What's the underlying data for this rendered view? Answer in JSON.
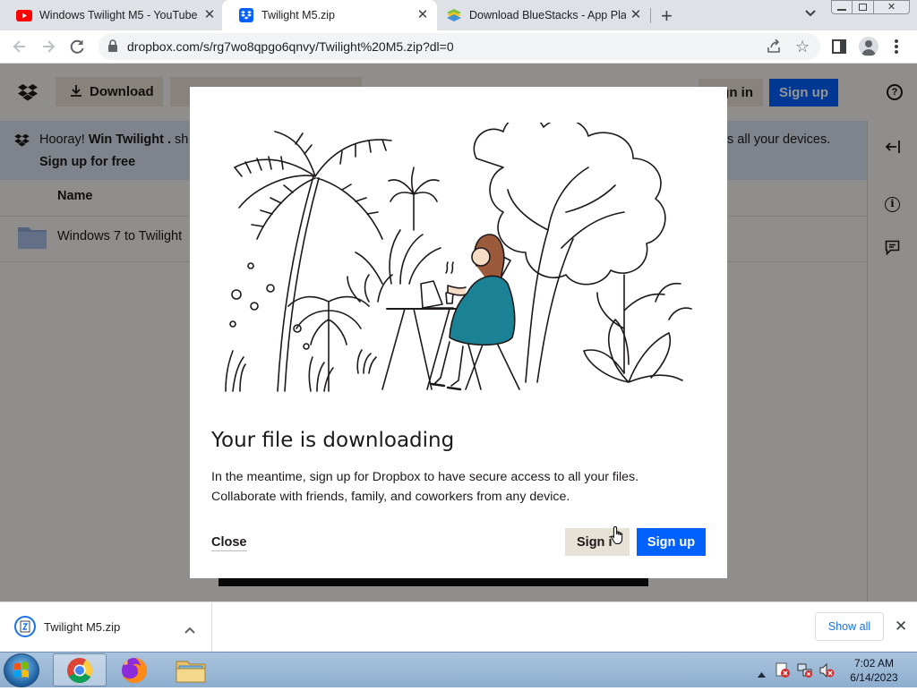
{
  "browser": {
    "tabs": [
      {
        "title": "Windows Twilight M5 - YouTube",
        "icon": "youtube-icon",
        "active": false
      },
      {
        "title": "Twilight M5.zip",
        "icon": "dropbox-icon",
        "active": true
      },
      {
        "title": "Download BlueStacks - App Playe",
        "icon": "bluestacks-icon",
        "active": false
      }
    ],
    "url": "dropbox.com/s/rg7wo8qpgo6qnvy/Twilight%20M5.zip?dl=0"
  },
  "dropbox": {
    "download_label": "Download",
    "sign_in_label": "Sign in",
    "sign_up_label": "Sign up",
    "banner": {
      "prefix": "Hooray! ",
      "bold": "Win Twilight .",
      "after": " sh",
      "right_text": "s all your devices.",
      "signup_link": "Sign up for free"
    },
    "list_header": "Name",
    "folder_name": "Windows 7 to Twilight"
  },
  "modal": {
    "title": "Your file is downloading",
    "body": "In the meantime, sign up for Dropbox to have secure access to all your files. Collaborate with friends, family, and coworkers from any device.",
    "close_label": "Close",
    "sign_in_label": "Sign i",
    "sign_up_label": "Sign up"
  },
  "download_shelf": {
    "file_name": "Twilight M5.zip",
    "show_all_label": "Show all"
  },
  "taskbar": {
    "time": "7:02 AM",
    "date": "6/14/2023"
  },
  "colors": {
    "dropbox_blue": "#0061fe",
    "dress_teal": "#1b8296",
    "banner_bg": "#dbe4f2"
  }
}
